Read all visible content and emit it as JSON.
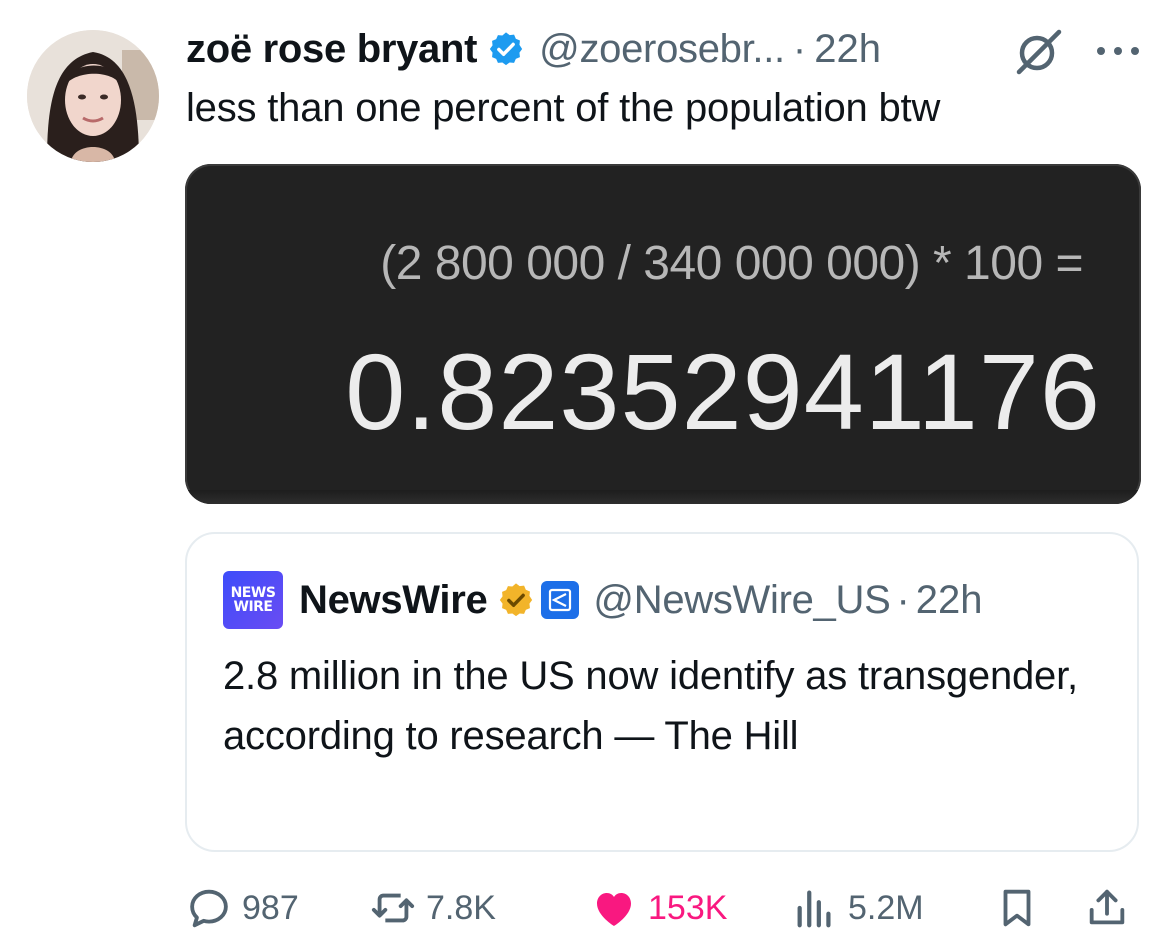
{
  "tweet": {
    "author_name": "zoë rose bryant",
    "handle": "@zoerosebr...",
    "separator": "·",
    "time": "22h",
    "text": "less than one percent of the population btw",
    "image": {
      "expression": "(2 800 000 / 340 000 000) * 100 =",
      "result": "0.8235294117​6"
    }
  },
  "quoted": {
    "logo_line1": "NEWS",
    "logo_line2": "WIRE",
    "author_name": "NewsWire",
    "handle": "@NewsWire_US",
    "separator": "·",
    "time": "22h",
    "text": "2.8 million in the US now identify as transgender, according to research — The Hill"
  },
  "actions": {
    "replies": "987",
    "reposts": "7.8K",
    "likes": "153K",
    "views": "5.2M"
  },
  "icons": [
    "verified-icon",
    "grok-icon",
    "more-icon",
    "reply-icon",
    "repost-icon",
    "heart-icon",
    "views-icon",
    "bookmark-icon",
    "share-icon"
  ],
  "colors": {
    "verified_blue": "#1d9bf0",
    "muted_text": "#536471",
    "like_pink": "#f91880",
    "gold_badge": "#f2b42a"
  }
}
